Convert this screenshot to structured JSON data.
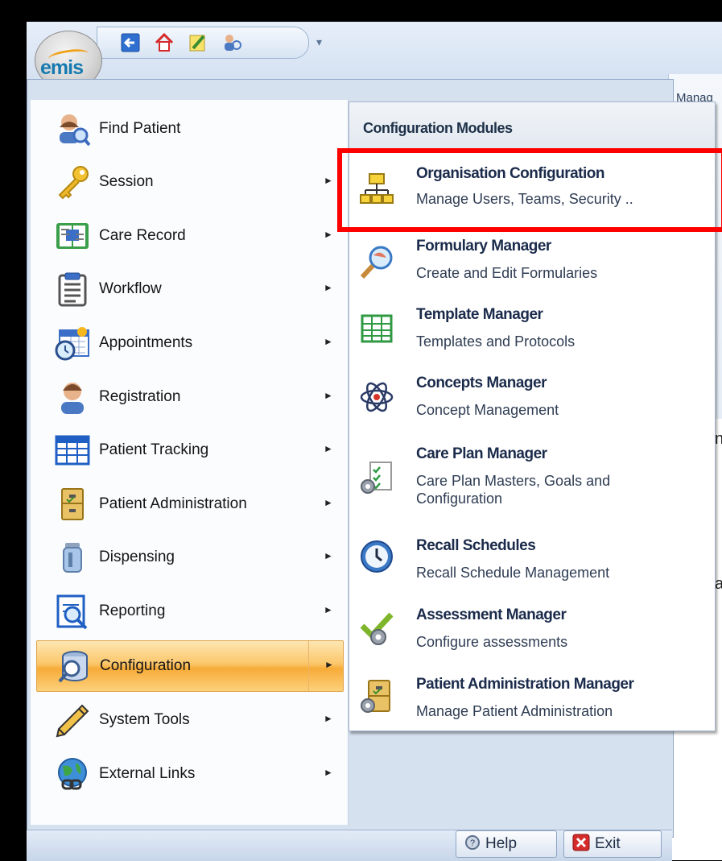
{
  "app": {
    "logo_text": "emis",
    "behind_tab_label": "Manag",
    "behind_chars": [
      "n",
      "a"
    ]
  },
  "quick_access": {
    "icons": [
      "back-arrow-icon",
      "home-icon",
      "edit-icon",
      "users-icon"
    ],
    "customize": "▾"
  },
  "left_menu": {
    "items": [
      {
        "label": "Find Patient",
        "icon": "find-patient-icon",
        "has_submenu": false
      },
      {
        "label": "Session",
        "icon": "key-icon",
        "has_submenu": true
      },
      {
        "label": "Care Record",
        "icon": "care-record-icon",
        "has_submenu": true
      },
      {
        "label": "Workflow",
        "icon": "clipboard-icon",
        "has_submenu": true
      },
      {
        "label": "Appointments",
        "icon": "calendar-clock-icon",
        "has_submenu": true
      },
      {
        "label": "Registration",
        "icon": "person-icon",
        "has_submenu": true
      },
      {
        "label": "Patient Tracking",
        "icon": "grid-icon",
        "has_submenu": true
      },
      {
        "label": "Patient Administration",
        "icon": "cabinet-icon",
        "has_submenu": true
      },
      {
        "label": "Dispensing",
        "icon": "bottle-icon",
        "has_submenu": true
      },
      {
        "label": "Reporting",
        "icon": "report-icon",
        "has_submenu": true
      },
      {
        "label": "Configuration",
        "icon": "database-search-icon",
        "has_submenu": true,
        "selected": true
      },
      {
        "label": "System Tools",
        "icon": "pencil-icon",
        "has_submenu": true
      },
      {
        "label": "External Links",
        "icon": "globe-link-icon",
        "has_submenu": true
      }
    ],
    "arrow": "►"
  },
  "submenu": {
    "header": "Configuration Modules",
    "items": [
      {
        "title": "Organisation Configuration",
        "desc": "Manage Users, Teams, Security ..",
        "icon": "org-chart-icon"
      },
      {
        "title": "Formulary Manager",
        "desc": "Create and Edit Formularies",
        "icon": "magnifier-icon"
      },
      {
        "title": "Template Manager",
        "desc": "Templates and Protocols",
        "icon": "table-icon"
      },
      {
        "title": "Concepts Manager",
        "desc": "Concept Management",
        "icon": "atom-icon"
      },
      {
        "title": "Care Plan Manager",
        "desc": "Care Plan Masters, Goals and",
        "desc2": "Configuration",
        "icon": "checklist-gear-icon"
      },
      {
        "title": "Recall Schedules",
        "desc": "Recall Schedule Management",
        "icon": "clock-icon"
      },
      {
        "title": "Assessment Manager",
        "desc": "Configure assessments",
        "icon": "check-gear-icon"
      },
      {
        "title": "Patient Administration Manager",
        "desc": "Manage Patient Administration",
        "icon": "cabinet-gear-icon"
      }
    ]
  },
  "footer": {
    "help_label": "Help",
    "exit_label": "Exit"
  },
  "colors": {
    "highlight_box": "#ff0000",
    "selected_bg": "#f7ab38"
  }
}
